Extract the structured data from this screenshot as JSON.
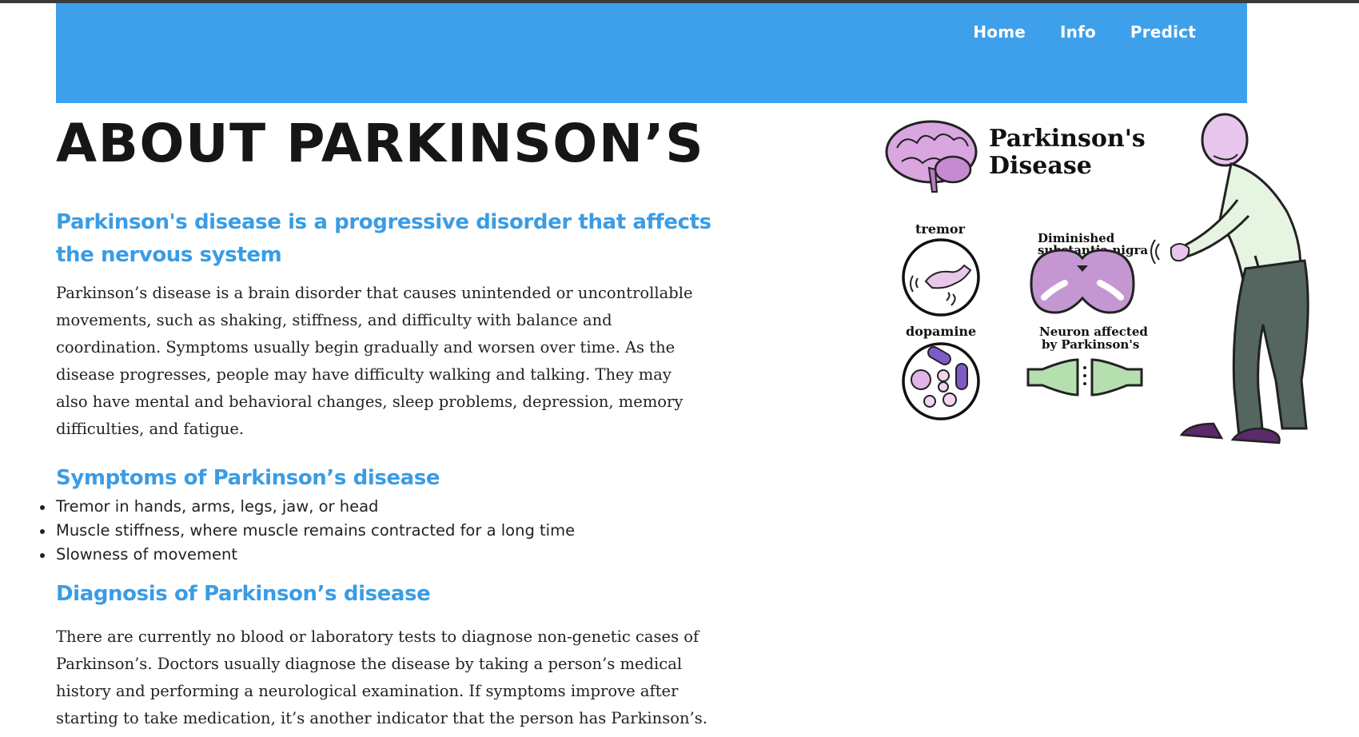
{
  "nav": {
    "links": [
      "Home",
      "Info",
      "Predict"
    ]
  },
  "page": {
    "title": "ABOUT PARKINSON’S"
  },
  "sections": {
    "intro": {
      "heading": "Parkinson's disease is a progressive disorder that affects the nervous system",
      "body": "Parkinson’s disease is a brain disorder that causes unintended or uncontrollable movements, such as shaking, stiffness, and difficulty with balance and coordination. Symptoms usually begin gradually and worsen over time. As the disease progresses, people may have difficulty walking and talking. They may also have mental and behavioral changes, sleep problems, depression, memory difficulties, and fatigue."
    },
    "symptoms": {
      "heading": "Symptoms of Parkinson’s disease",
      "items": [
        "Tremor in hands, arms, legs, jaw, or head",
        "Muscle stiffness, where muscle remains contracted for a long time",
        "Slowness of movement"
      ]
    },
    "diagnosis": {
      "heading": "Diagnosis of Parkinson’s disease",
      "body": "There are currently no blood or laboratory tests to diagnose non-genetic cases of Parkinson’s. Doctors usually diagnose the disease by taking a person’s medical history and performing a neurological examination. If symptoms improve after starting to take medication, it’s another indicator that the person has Parkinson’s."
    }
  },
  "illustration": {
    "title_line1": "Parkinson's",
    "title_line2": "Disease",
    "label_tremor": "tremor",
    "label_dopamine": "dopamine",
    "label_nigra_line1": "Diminished",
    "label_nigra_line2": "substantia nigra",
    "label_neuron_line1": "Neuron affected",
    "label_neuron_line2": "by Parkinson's"
  },
  "colors": {
    "navbar": "#3ea0ea",
    "accent_heading": "#3a9ce5",
    "title_text": "#161616",
    "brain_purple": "#c99ad6",
    "neuron_green": "#b6dfb0"
  }
}
